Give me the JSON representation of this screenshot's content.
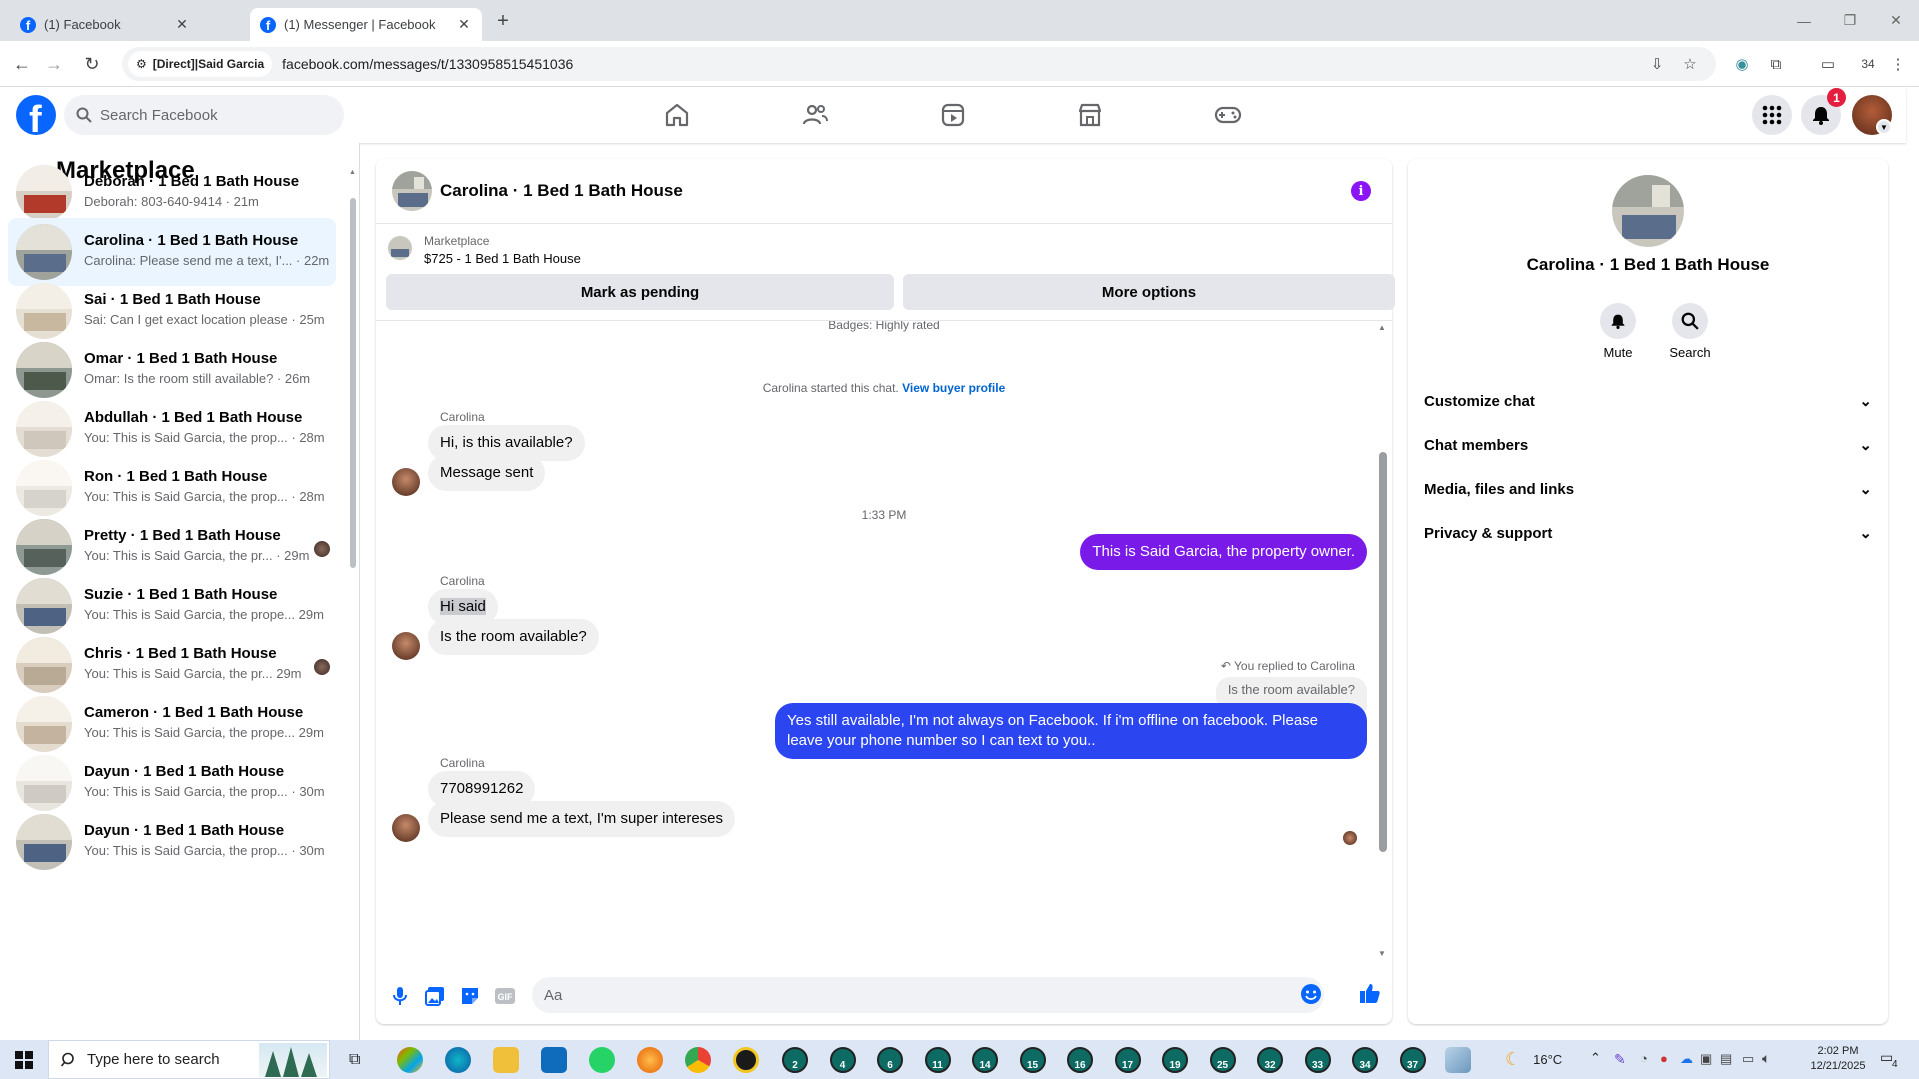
{
  "browser": {
    "tabs": [
      {
        "title": "(1) Facebook"
      },
      {
        "title": "(1) Messenger | Facebook"
      }
    ],
    "site_chip": "[Direct]|Said Garcia",
    "url": "facebook.com/messages/t/1330958515451036",
    "profile_count": "34"
  },
  "header": {
    "search_placeholder": "Search Facebook",
    "notif_count": "1"
  },
  "left": {
    "title": "Marketplace",
    "conversations": [
      {
        "name": "Deborah · 1 Bed 1 Bath House",
        "preview": "Deborah: 803-640-9414 · 21m"
      },
      {
        "name": "Carolina · 1 Bed 1 Bath House",
        "preview": "Carolina: Please send me a text, I'... · 22m"
      },
      {
        "name": "Sai · 1 Bed 1 Bath House",
        "preview": "Sai: Can I get exact location please · 25m"
      },
      {
        "name": "Omar · 1 Bed 1 Bath House",
        "preview": "Omar: Is the room still available? · 26m"
      },
      {
        "name": "Abdullah · 1 Bed 1 Bath House",
        "preview": "You: This is Said Garcia, the prop... · 28m"
      },
      {
        "name": "Ron · 1 Bed 1 Bath House",
        "preview": "You: This is Said Garcia, the prop... · 28m"
      },
      {
        "name": "Pretty · 1 Bed 1 Bath House",
        "preview": "You: This is Said Garcia, the pr... · 29m"
      },
      {
        "name": "Suzie · 1 Bed 1 Bath House",
        "preview": "You: This is Said Garcia, the prope... 29m"
      },
      {
        "name": "Chris · 1 Bed 1 Bath House",
        "preview": "You: This is Said Garcia, the pr... 29m"
      },
      {
        "name": "Cameron · 1 Bed 1 Bath House",
        "preview": "You: This is Said Garcia, the prope... 29m"
      },
      {
        "name": "Dayun · 1 Bed 1 Bath House",
        "preview": "You: This is Said Garcia, the prop... · 30m"
      },
      {
        "name": "Dayun · 1 Bed 1 Bath House",
        "preview": "You: This is Said Garcia, the prop... · 30m"
      }
    ]
  },
  "chat": {
    "title": "Carolina · 1 Bed 1 Bath House",
    "marketplace_label": "Marketplace",
    "listing": "$725 - 1 Bed 1 Bath House",
    "mark_pending": "Mark as pending",
    "more_options": "More options",
    "badges": "Badges: Highly rated",
    "started_text": "Carolina started this chat.",
    "view_buyer": "View buyer profile",
    "sender": "Carolina",
    "msg1": "Hi, is this available?",
    "msg2": "Message sent",
    "time": "1:33 PM",
    "out1": "This is Said Garcia, the property owner.",
    "msg3": "Hi said",
    "msg4": "Is the room available?",
    "replied_to": "You replied to Carolina",
    "quoted": "Is the room available?",
    "out2": "Yes still available, I'm not always on Facebook. If i'm offline on facebook. Please leave your phone number so I can text to you..",
    "msg5": "7708991262",
    "msg6": "Please send me a text, I'm super intereses",
    "composer_placeholder": "Aa"
  },
  "right": {
    "name": "Carolina · 1 Bed 1 Bath House",
    "mute": "Mute",
    "search": "Search",
    "sections": [
      "Customize chat",
      "Chat members",
      "Media, files and links",
      "Privacy & support"
    ]
  },
  "taskbar": {
    "search_placeholder": "Type here to search",
    "badges": [
      "2",
      "4",
      "6",
      "11",
      "14",
      "15",
      "16",
      "17",
      "19",
      "25",
      "32",
      "33",
      "34",
      "37"
    ],
    "weather": "16°C",
    "time": "2:02 PM",
    "date": "12/21/2025",
    "notif_count": "4"
  },
  "colors": {
    "accent_purple": "#8a14f5",
    "bubble_out_1": "#7a1ae8",
    "bubble_out_2": "#2b46f0",
    "fb_blue": "#0866ff"
  }
}
